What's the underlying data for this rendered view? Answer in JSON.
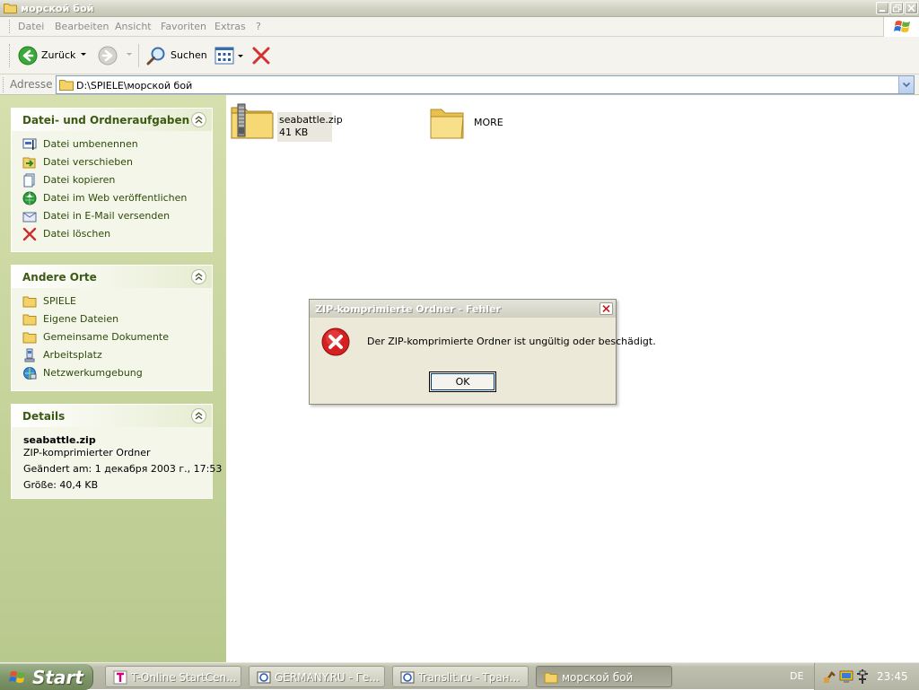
{
  "window": {
    "title": "морской бой",
    "minimize_icon": "minimize-icon",
    "maximize_icon": "maximize-icon",
    "close_icon": "close-icon"
  },
  "menu": {
    "items": [
      "Datei",
      "Bearbeiten",
      "Ansicht",
      "Favoriten",
      "Extras",
      "?"
    ]
  },
  "toolbar": {
    "back_label": "Zurück",
    "search_label": "Suchen"
  },
  "address": {
    "label": "Adresse",
    "path": "D:\\SPIELE\\морской бой"
  },
  "tasks_panel": {
    "title": "Datei- und Ordneraufgaben",
    "items": [
      {
        "label": "Datei umbenennen",
        "icon": "rename-icon"
      },
      {
        "label": "Datei verschieben",
        "icon": "move-icon"
      },
      {
        "label": "Datei kopieren",
        "icon": "copy-icon"
      },
      {
        "label": "Datei im Web veröffentlichen",
        "icon": "web-publish-icon"
      },
      {
        "label": "Datei in E-Mail versenden",
        "icon": "email-icon"
      },
      {
        "label": "Datei löschen",
        "icon": "delete-icon"
      }
    ]
  },
  "places_panel": {
    "title": "Andere Orte",
    "items": [
      {
        "label": "SPIELE",
        "icon": "folder-icon"
      },
      {
        "label": "Eigene Dateien",
        "icon": "folder-icon"
      },
      {
        "label": "Gemeinsame Dokumente",
        "icon": "folder-icon"
      },
      {
        "label": "Arbeitsplatz",
        "icon": "computer-icon"
      },
      {
        "label": "Netzwerkumgebung",
        "icon": "network-icon"
      }
    ]
  },
  "details_panel": {
    "title": "Details",
    "name": "seabattle.zip",
    "type": "ZIP-komprimierter Ordner",
    "modified": "Geändert am: 1 декабря 2003 г., 17:53",
    "size": "Größe: 40,4 KB"
  },
  "files": [
    {
      "name": "seabattle.zip",
      "size": "41 KB",
      "icon": "zip-folder-icon",
      "selected": true
    },
    {
      "name": "MORE",
      "size": "",
      "icon": "folder-icon",
      "selected": false
    }
  ],
  "dialog": {
    "title": "ZIP-komprimierte Ordner - Fehler",
    "message": "Der ZIP-komprimierte Ordner ist ungültig oder beschädigt.",
    "ok_label": "OK",
    "icon": "error-icon"
  },
  "taskbar": {
    "start_label": "Start",
    "buttons": [
      {
        "label": "T-Online StartCen...",
        "active": false
      },
      {
        "label": "GERMANY.RU - Ге...",
        "active": false
      },
      {
        "label": "Translit.ru - Тран...",
        "active": false
      },
      {
        "label": "морской бой",
        "active": true
      }
    ],
    "language": "DE",
    "clock": "23:45"
  },
  "colors": {
    "accent_green": "#3c5a14",
    "error_red": "#d42020",
    "delete_red": "#d43030"
  }
}
